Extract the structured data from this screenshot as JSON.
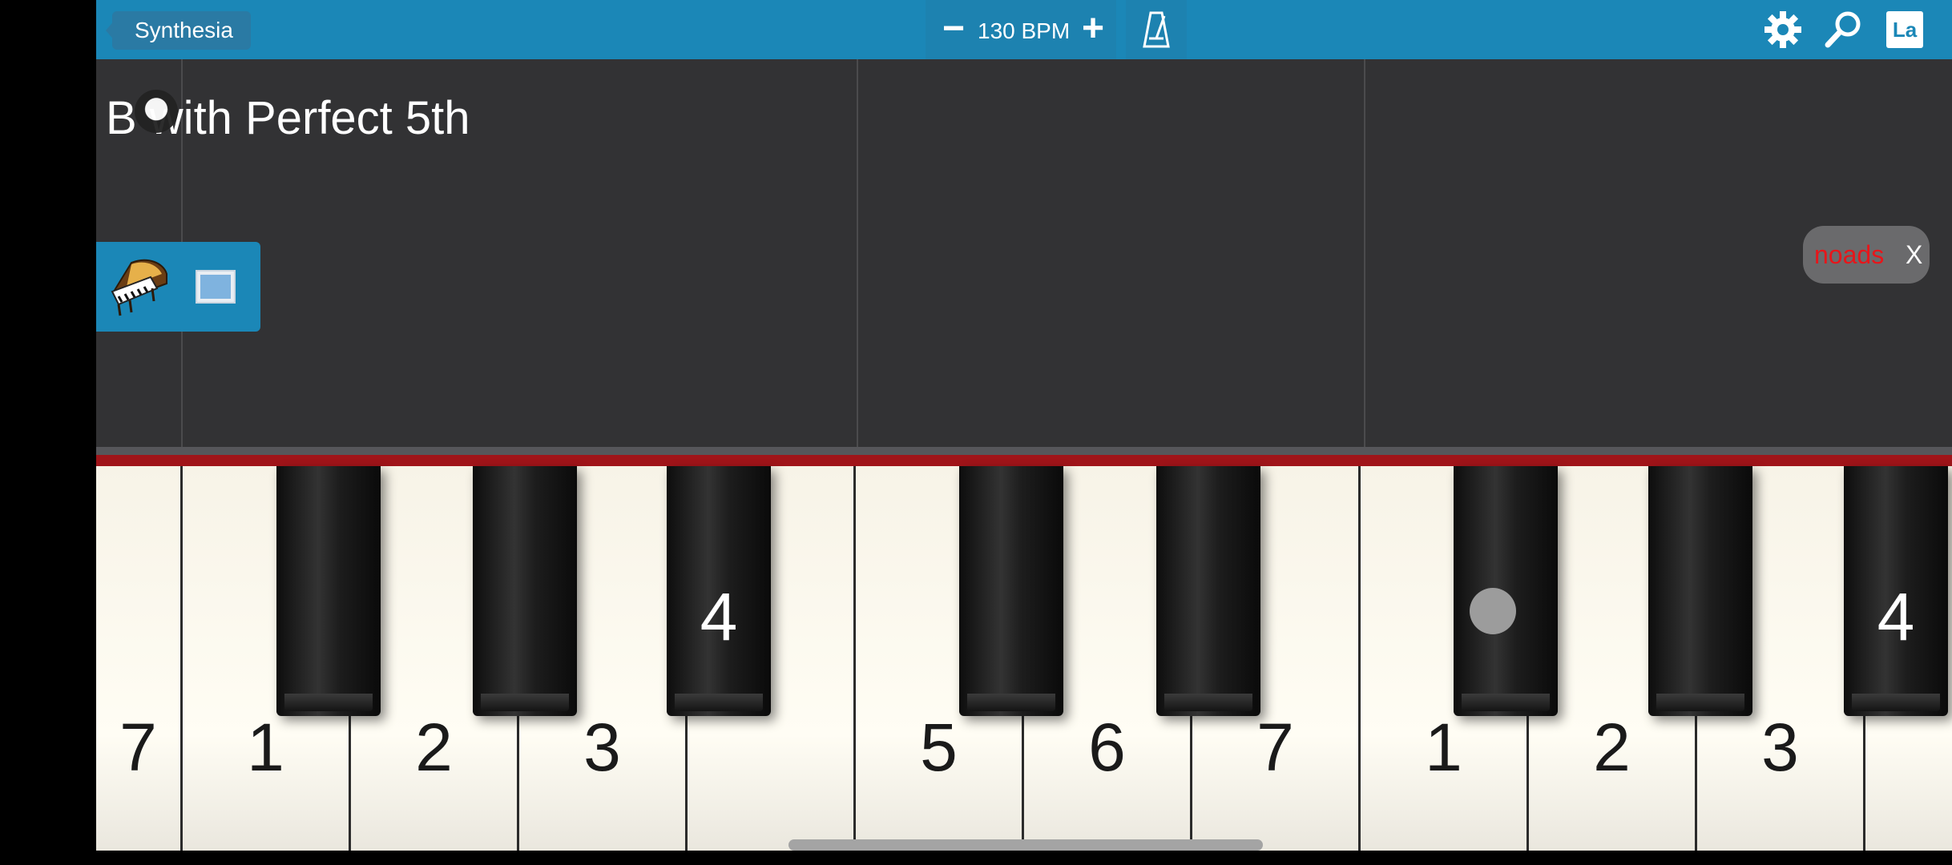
{
  "header": {
    "back_label": "Synthesia",
    "tempo_minus": "−",
    "tempo_text": "130 BPM",
    "tempo_plus": "+",
    "metronome_icon": "metronome-icon",
    "settings_icon": "gear-icon",
    "search_icon": "magnifier-icon",
    "language_label": "La"
  },
  "song": {
    "title": "B with Perfect 5th"
  },
  "instrument": {
    "icon": "grand-piano-icon",
    "toggle_icon": "view-toggle-icon"
  },
  "ad": {
    "label": "noads",
    "close": "X"
  },
  "keyboard": {
    "white_keys": [
      {
        "label": "7"
      },
      {
        "label": "1"
      },
      {
        "label": "2"
      },
      {
        "label": "3"
      },
      {
        "label": ""
      },
      {
        "label": "5"
      },
      {
        "label": "6"
      },
      {
        "label": "7"
      },
      {
        "label": "1"
      },
      {
        "label": "2"
      },
      {
        "label": "3"
      },
      {
        "label": ""
      }
    ],
    "black_keys": [
      {
        "label": ""
      },
      {
        "label": ""
      },
      {
        "label": "4"
      },
      {
        "label": ""
      },
      {
        "label": ""
      },
      {
        "label": ""
      },
      {
        "label": ""
      },
      {
        "label": "4"
      }
    ]
  },
  "colors": {
    "accent": "#1b87b7",
    "rail": "#a01419",
    "noads_text": "#e8151a"
  }
}
